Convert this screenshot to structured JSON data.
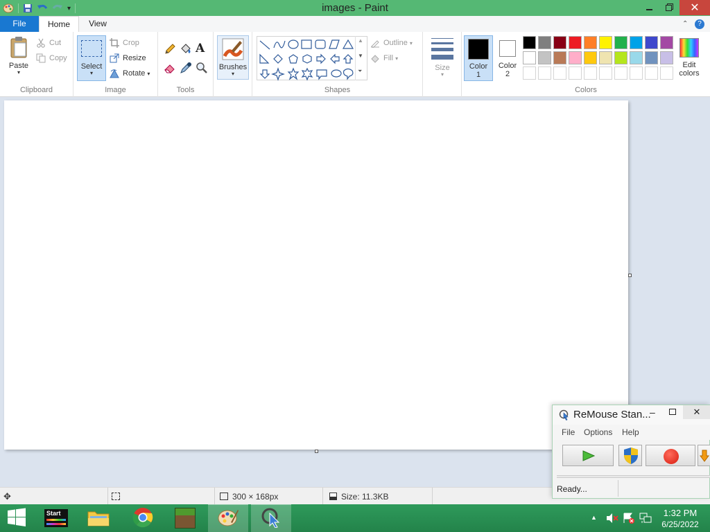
{
  "window": {
    "title": "images - Paint"
  },
  "tabs": {
    "file": "File",
    "home": "Home",
    "view": "View"
  },
  "ribbon": {
    "clipboard": {
      "label": "Clipboard",
      "paste": "Paste",
      "cut": "Cut",
      "copy": "Copy"
    },
    "image": {
      "label": "Image",
      "select": "Select",
      "crop": "Crop",
      "resize": "Resize",
      "rotate": "Rotate"
    },
    "tools": {
      "label": "Tools"
    },
    "brushes": {
      "label": "Brushes"
    },
    "shapes": {
      "label": "Shapes",
      "outline": "Outline",
      "fill": "Fill"
    },
    "size": {
      "label": "Size"
    },
    "colors": {
      "label": "Colors",
      "color1": "Color 1",
      "color2": "Color 2",
      "edit": "Edit colors",
      "color1_value": "#000000",
      "color2_value": "#ffffff",
      "palette_row1": [
        "#000000",
        "#7f7f7f",
        "#880015",
        "#ed1c24",
        "#ff7f27",
        "#fff200",
        "#22b14c",
        "#00a2e8",
        "#3f48cc",
        "#a349a4"
      ],
      "palette_row2": [
        "#ffffff",
        "#c3c3c3",
        "#b97a57",
        "#ffaec9",
        "#ffc90e",
        "#efe4b0",
        "#b5e61d",
        "#99d9ea",
        "#7092be",
        "#c8bfe7"
      ]
    }
  },
  "status": {
    "dimensions": "300 × 168px",
    "size": "Size: 11.3KB"
  },
  "remouse": {
    "title": "ReMouse Stan...",
    "menu": {
      "file": "File",
      "options": "Options",
      "help": "Help"
    },
    "status": "Ready..."
  },
  "taskbar": {
    "start_label": "Start",
    "time": "1:32 PM",
    "date": "6/25/2022"
  }
}
